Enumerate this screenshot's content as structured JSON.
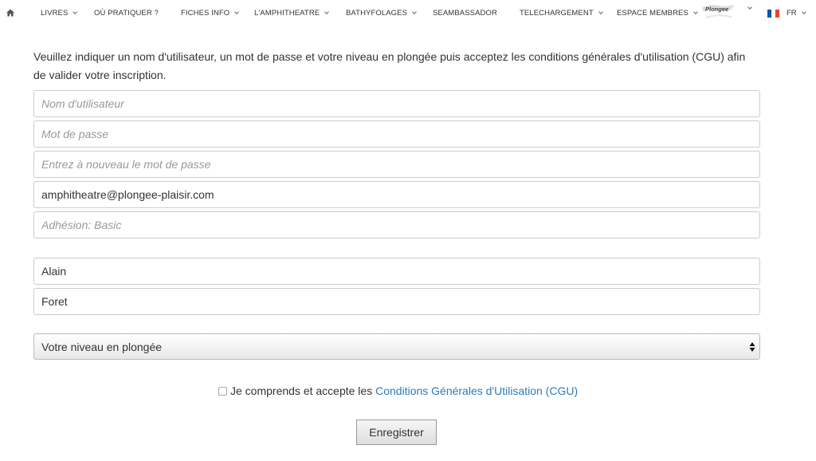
{
  "nav": {
    "home_icon": "home-icon",
    "items": [
      {
        "label": "LIVRES",
        "has_dropdown": true
      },
      {
        "label": "OÙ PRATIQUER ?",
        "has_dropdown": false
      },
      {
        "label": "FICHES INFO",
        "has_dropdown": true
      },
      {
        "label": "L'AMPHITHEATRE",
        "has_dropdown": true
      },
      {
        "label": "BATHYFOLAGES",
        "has_dropdown": true
      },
      {
        "label": "SEAMBASSADOR",
        "has_dropdown": false
      },
      {
        "label": "TELECHARGEMENT",
        "has_dropdown": true
      },
      {
        "label": "ESPACE MEMBRES",
        "has_dropdown": true
      }
    ],
    "logo_text": "Plongee",
    "language": "FR",
    "flag_colors": [
      "#0055a4",
      "#ffffff",
      "#ef4135"
    ]
  },
  "form": {
    "intro": "Veuillez indiquer un nom d'utilisateur, un mot de passe et votre niveau en plongée puis acceptez les conditions générales d'utilisation (CGU) afin de valider votre inscription.",
    "username_placeholder": "Nom d'utilisateur",
    "password_placeholder": "Mot de passe",
    "password_confirm_placeholder": "Entrez à nouveau le mot de passe",
    "email_value": "amphitheatre@plongee-plaisir.com",
    "membership_placeholder": "Adhésion: Basic",
    "first_name_value": "Alain",
    "last_name_value": "Foret",
    "level_select_value": "Votre niveau en plongée",
    "cgu_text": "Je comprends et accepte les ",
    "cgu_link": "Conditions Générales d'Utilisation (CGU)",
    "cgu_checked": false,
    "submit_label": "Enregistrer"
  },
  "colors": {
    "link": "#2b7bb9",
    "border": "#cccccc"
  }
}
